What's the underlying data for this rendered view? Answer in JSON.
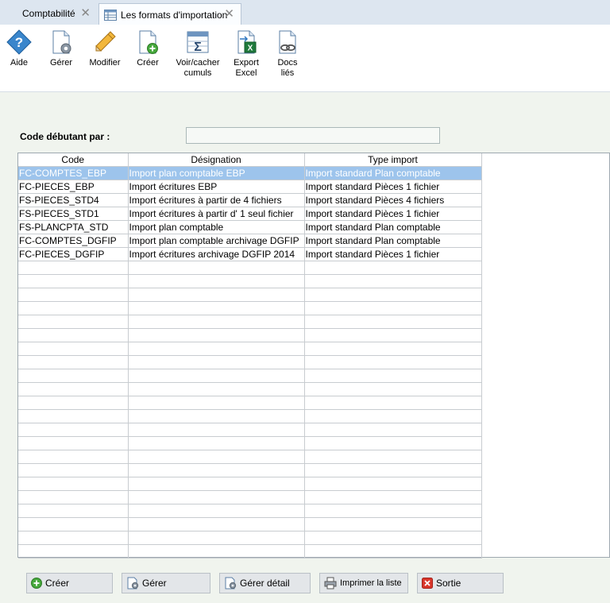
{
  "tabs": [
    {
      "label": "Comptabilité",
      "close": "✕"
    },
    {
      "label": "Les formats d'importation",
      "close": "✕"
    }
  ],
  "toolbar": {
    "aide": "Aide",
    "gerer": "Gérer",
    "modifier": "Modifier",
    "creer": "Créer",
    "voir_line1": "Voir/cacher",
    "voir_line2": "cumuls",
    "export_line1": "Export",
    "export_line2": "Excel",
    "docs_line1": "Docs",
    "docs_line2": "liés"
  },
  "filter": {
    "label": "Code débutant par :",
    "value": ""
  },
  "grid": {
    "columns": [
      "Code",
      "Désignation",
      "Type import"
    ],
    "rows": [
      [
        "FC-COMPTES_EBP",
        "Import plan comptable EBP",
        "Import standard Plan comptable"
      ],
      [
        "FC-PIECES_EBP",
        "Import écritures EBP",
        "Import standard Pièces 1 fichier"
      ],
      [
        "FS-PIECES_STD4",
        "Import écritures à partir de 4 fichiers",
        "Import standard Pièces 4 fichiers"
      ],
      [
        "FS-PIECES_STD1",
        "Import écritures à partir d' 1 seul fichier",
        "Import standard Pièces 1 fichier"
      ],
      [
        "FS-PLANCPTA_STD",
        "Import plan comptable",
        "Import standard Plan comptable"
      ],
      [
        "FC-COMPTES_DGFIP",
        "Import plan comptable archivage DGFIP",
        "Import standard Plan comptable"
      ],
      [
        "FC-PIECES_DGFIP",
        "Import écritures archivage DGFIP 2014",
        "Import standard Pièces 1 fichier"
      ]
    ],
    "selected_row": 0,
    "empty_rows": 22
  },
  "buttons": {
    "creer": "Créer",
    "gerer": "Gérer",
    "gerer_detail": "Gérer détail",
    "imprimer": "Imprimer la liste",
    "sortie": "Sortie"
  },
  "colors": {
    "selection": "#9dc4ec",
    "accent": "#2f77c0"
  }
}
